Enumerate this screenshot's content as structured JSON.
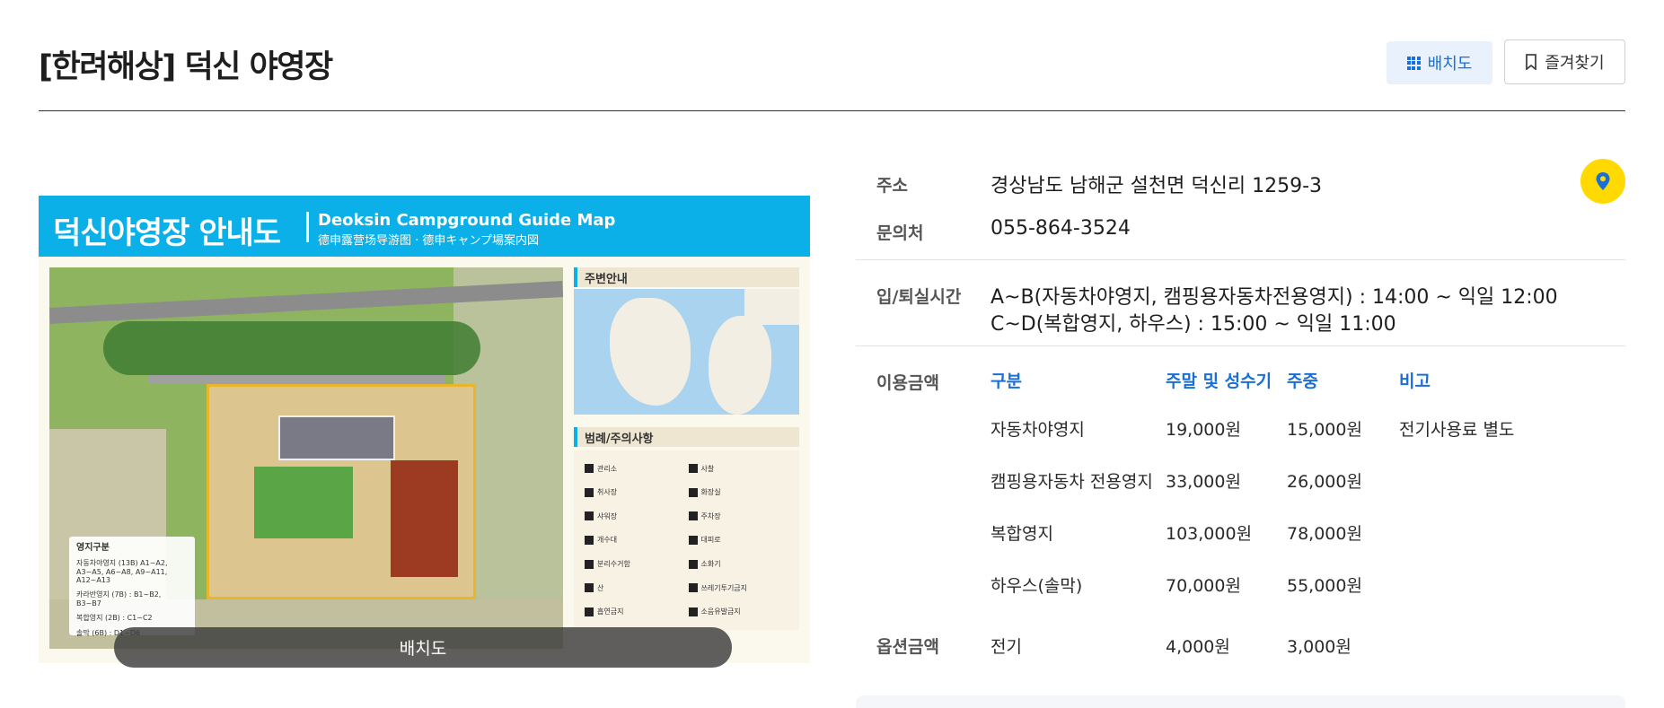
{
  "header": {
    "title": "[한려해상] 덕신 야영장",
    "layout_button": "배치도",
    "favorite_button": "즐겨찾기"
  },
  "map": {
    "banner_ko": "덕신야영장 안내도",
    "banner_en": "Deoksin Campground Guide Map",
    "banner_cjk": "德申露营场导游图 · 德申キャンプ場案内図",
    "neighborhood_title": "주변안내",
    "legend_title": "범례/주의사항",
    "site_legend_title": "영지구분",
    "site_legend_items": [
      "자동차야영지 (13B) A1~A2, A3~A5, A6~A8, A9~A11, A12~A13",
      "카라반영지 (7B) : B1~B2, B3~B7",
      "복합영지 (2B) : C1~C2",
      "솔막 (6B) : D1~D6"
    ],
    "legend_items": [
      "관리소",
      "사찰",
      "취사장",
      "화장실",
      "샤워장",
      "주차장",
      "개수대",
      "대피로",
      "분리수거함",
      "소화기",
      "산",
      "쓰레기투기금지",
      "흡연금지",
      "소음유발금지"
    ],
    "caption": "배치도"
  },
  "info": {
    "address_label": "주소",
    "address": "경상남도 남해군 설천면 덕신리 1259-3",
    "phone_label": "문의처",
    "phone": "055-864-3524",
    "checkin_label": "입/퇴실시간",
    "checkin_line1": "A~B(자동차야영지, 캠핑용자동차전용영지) : 14:00 ~ 익일 12:00",
    "checkin_line2": "C~D(복합영지, 하우스) : 15:00 ~ 익일 11:00",
    "price_label": "이용금액",
    "price_headers": [
      "구분",
      "주말 및 성수기",
      "주중",
      "비고"
    ],
    "price_rows": [
      {
        "type": "자동차야영지",
        "peak": "19,000원",
        "weekday": "15,000원",
        "note": "전기사용료 별도"
      },
      {
        "type": "캠핑용자동차 전용영지",
        "peak": "33,000원",
        "weekday": "26,000원",
        "note": ""
      },
      {
        "type": "복합영지",
        "peak": "103,000원",
        "weekday": "78,000원",
        "note": ""
      },
      {
        "type": "하우스(솔막)",
        "peak": "70,000원",
        "weekday": "55,000원",
        "note": ""
      }
    ],
    "option_label": "옵션금액",
    "option_row": {
      "type": "전기",
      "peak": "4,000원",
      "weekday": "3,000원"
    }
  },
  "colors": {
    "accent": "#1a6fd4",
    "pin": "#ffd900",
    "map_banner": "#0bb0e8"
  }
}
